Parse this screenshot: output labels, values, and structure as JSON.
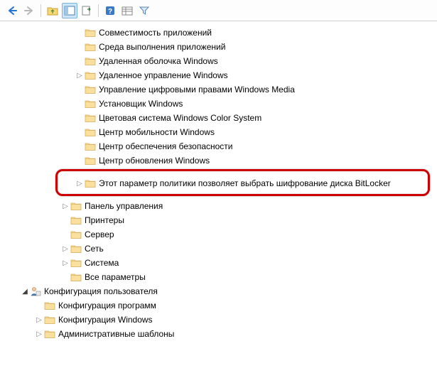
{
  "toolbar": {
    "back": "back",
    "forward": "forward",
    "up": "up",
    "show_hide": "show-hide-tree",
    "export": "export-list",
    "help": "help",
    "properties": "properties",
    "filter": "filter"
  },
  "tree": {
    "indent_base": 105,
    "items": [
      {
        "label": "Совместимость приложений",
        "expander": "",
        "icon": "folder",
        "indent": 105
      },
      {
        "label": "Среда выполнения приложений",
        "expander": "",
        "icon": "folder",
        "indent": 105
      },
      {
        "label": "Удаленная оболочка Windows",
        "expander": "",
        "icon": "folder",
        "indent": 105
      },
      {
        "label": "Удаленное управление Windows",
        "expander": "▷",
        "icon": "folder",
        "indent": 105
      },
      {
        "label": "Управление цифровыми правами Windows Media",
        "expander": "",
        "icon": "folder",
        "indent": 105
      },
      {
        "label": "Установщик Windows",
        "expander": "",
        "icon": "folder",
        "indent": 105
      },
      {
        "label": "Цветовая система Windows Color System",
        "expander": "",
        "icon": "folder",
        "indent": 105
      },
      {
        "label": "Центр мобильности Windows",
        "expander": "",
        "icon": "folder",
        "indent": 105
      },
      {
        "label": "Центр обеспечения безопасности",
        "expander": "",
        "icon": "folder",
        "indent": 105
      },
      {
        "label": "Центр обновления Windows",
        "expander": "",
        "icon": "folder",
        "indent": 105
      },
      {
        "label": "",
        "expander": "",
        "icon": "folder",
        "indent": 105,
        "hidden_by_highlight": true
      },
      {
        "label": "Этот параметр политики позволяет выбрать шифрование диска BitLocker",
        "expander": "▷",
        "icon": "folder",
        "indent": 105,
        "highlighted": true
      },
      {
        "label": "",
        "expander": "",
        "icon": "none",
        "indent": 105,
        "hidden_by_highlight": true
      },
      {
        "label": "Панель управления",
        "expander": "▷",
        "icon": "folder",
        "indent": 85
      },
      {
        "label": "Принтеры",
        "expander": "",
        "icon": "folder",
        "indent": 85
      },
      {
        "label": "Сервер",
        "expander": "",
        "icon": "folder",
        "indent": 85
      },
      {
        "label": "Сеть",
        "expander": "▷",
        "icon": "folder",
        "indent": 85
      },
      {
        "label": "Система",
        "expander": "▷",
        "icon": "folder",
        "indent": 85
      },
      {
        "label": "Все параметры",
        "expander": "",
        "icon": "folder",
        "indent": 85
      }
    ],
    "user_config": {
      "label": "Конфигурация пользователя",
      "expander": "◢",
      "indent": 28,
      "children": [
        {
          "label": "Конфигурация программ",
          "expander": "",
          "icon": "folder",
          "indent": 48
        },
        {
          "label": "Конфигурация Windows",
          "expander": "▷",
          "icon": "folder",
          "indent": 48
        },
        {
          "label": "Административные шаблоны",
          "expander": "▷",
          "icon": "folder",
          "indent": 48
        }
      ]
    }
  }
}
